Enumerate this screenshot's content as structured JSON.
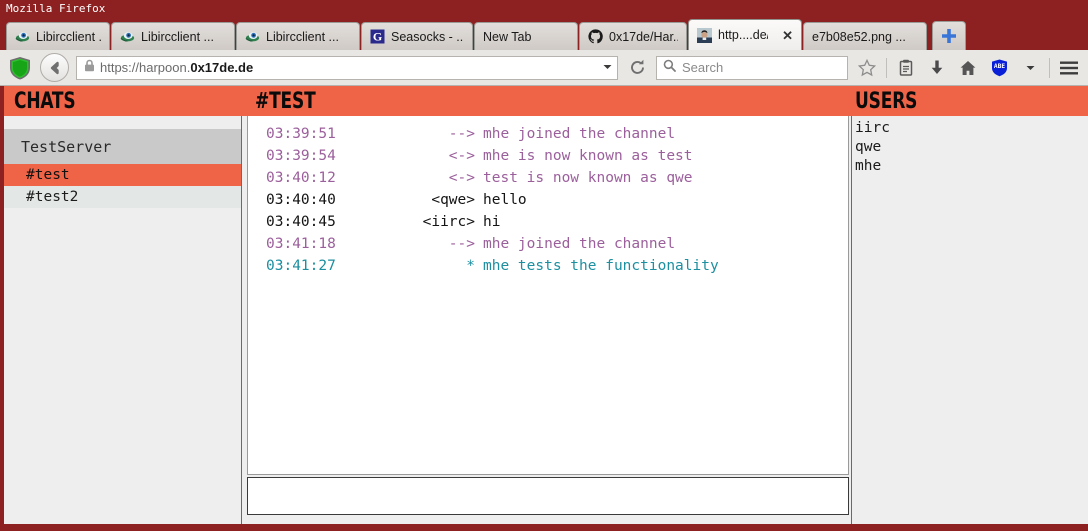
{
  "window": {
    "title": "Mozilla Firefox"
  },
  "browser": {
    "tabs": [
      {
        "label": "Libircclient ...",
        "favicon": "libircclient-icon",
        "active": false,
        "closable": false
      },
      {
        "label": "Libircclient ...",
        "favicon": "libircclient-icon",
        "active": false,
        "closable": false
      },
      {
        "label": "Libircclient ...",
        "favicon": "libircclient-icon",
        "active": false,
        "closable": false
      },
      {
        "label": "Seasocks - ...",
        "favicon": "seasocks-g-icon",
        "active": false,
        "closable": false
      },
      {
        "label": "New Tab",
        "favicon": "none",
        "active": false,
        "closable": false
      },
      {
        "label": "0x17de/Har...",
        "favicon": "github-icon",
        "active": false,
        "closable": false
      },
      {
        "label": "http....de/",
        "favicon": "avatar-photo-icon",
        "active": true,
        "closable": true
      },
      {
        "label": "e7b08e52.png ...",
        "favicon": "none",
        "active": false,
        "closable": false
      }
    ],
    "new_tab_label": "+",
    "close_label": "✕",
    "url": {
      "scheme_host_prefix": "https://harpoon.",
      "domain": "0x17de.de",
      "full": "https://harpoon.0x17de.de"
    },
    "search": {
      "placeholder": "Search"
    },
    "toolbar_icons": [
      "noscript-shield-icon",
      "back-icon",
      "lock-icon",
      "url-dropdown-icon",
      "reload-icon",
      "search-icon",
      "bookmark-star-icon",
      "reader-icon",
      "downloads-icon",
      "home-icon",
      "abe-shield-icon",
      "abe-dropdown-icon",
      "menu-icon"
    ]
  },
  "app": {
    "accent_color": "#ef6347",
    "headers": {
      "chats": "CHATS",
      "channel": "#TEST",
      "users": "USERS"
    },
    "sidebar": {
      "servers": [
        {
          "name": "TestServer",
          "channels": [
            {
              "name": "#test",
              "active": true
            },
            {
              "name": "#test2",
              "active": false
            }
          ]
        }
      ]
    },
    "messages": [
      {
        "time": "03:39:51",
        "from": "-->",
        "text": "mhe joined the channel",
        "kind": "system"
      },
      {
        "time": "03:39:54",
        "from": "<->",
        "text": "mhe is now known as test",
        "kind": "system"
      },
      {
        "time": "03:40:12",
        "from": "<->",
        "text": "test is now known as qwe",
        "kind": "system"
      },
      {
        "time": "03:40:40",
        "from": "<qwe>",
        "text": "hello",
        "kind": "normal"
      },
      {
        "time": "03:40:45",
        "from": "<iirc>",
        "text": "hi",
        "kind": "normal"
      },
      {
        "time": "03:41:18",
        "from": "-->",
        "text": "mhe joined the channel",
        "kind": "system"
      },
      {
        "time": "03:41:27",
        "from": "*",
        "text": "mhe tests the functionality",
        "kind": "action"
      }
    ],
    "input": {
      "value": "",
      "placeholder": ""
    },
    "users": [
      "iirc",
      "qwe",
      "mhe"
    ]
  }
}
